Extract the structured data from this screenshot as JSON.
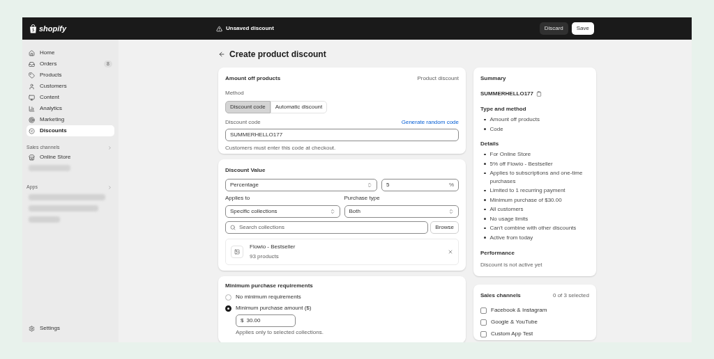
{
  "top_bar": {
    "logo_text": "shopify",
    "status": "Unsaved discount",
    "buttons": [
      {
        "label": "Discard",
        "kind": "secondary"
      },
      {
        "label": "Save",
        "kind": "primary"
      }
    ]
  },
  "sidebar": {
    "items": [
      {
        "label": "Home",
        "selected": false
      },
      {
        "label": "Orders",
        "badge": "8",
        "selected": false
      },
      {
        "label": "Products",
        "selected": false
      },
      {
        "label": "Customers",
        "selected": false
      },
      {
        "label": "Content",
        "selected": false
      },
      {
        "label": "Analytics",
        "selected": false
      },
      {
        "label": "Marketing",
        "selected": false
      },
      {
        "label": "Discounts",
        "selected": true
      }
    ],
    "sales_channels": {
      "heading": "Sales channels",
      "items": [
        {
          "label": "Online Store"
        }
      ]
    },
    "apps": {
      "heading": "Apps"
    },
    "settings": "Settings"
  },
  "page": {
    "title": "Create product discount"
  },
  "method_card": {
    "title": "Amount off products",
    "type_label": "Product discount",
    "method_label": "Method",
    "methods": [
      {
        "label": "Discount code",
        "selected": true
      },
      {
        "label": "Automatic discount",
        "selected": false
      }
    ],
    "code_label": "Discount code",
    "generate_link": "Generate random code",
    "code_value": "SUMMERHELLO177",
    "help": "Customers must enter this code at checkout."
  },
  "value_card": {
    "title": "Discount Value",
    "value_type": "Percentage",
    "amount": "5",
    "amount_suffix": "%",
    "applies_label": "Applies to",
    "applies_value": "Specific collections",
    "purchase_label": "Purchase type",
    "purchase_value": "Both",
    "search_placeholder": "Search collections",
    "browse": "Browse",
    "collections": [
      {
        "name": "Flowio - Bestseller",
        "count": "93 products"
      }
    ]
  },
  "requirements_card": {
    "title": "Minimum purchase requirements",
    "options": [
      {
        "label": "No minimum requirements",
        "selected": false
      },
      {
        "label": "Minimum purchase amount ($)",
        "selected": true
      }
    ],
    "amount_prefix": "$",
    "amount": "30.00",
    "help": "Applies only to selected collections."
  },
  "summary": {
    "title": "Summary",
    "code": "SUMMERHELLO177",
    "sections": [
      {
        "heading": "Type and method",
        "items": [
          "Amount off products",
          "Code"
        ]
      },
      {
        "heading": "Details",
        "items": [
          "For Online Store",
          "5% off Flowio - Bestseller",
          "Applies to subscriptions and one-time purchases",
          "Limited to 1 recurring payment",
          "Minimum purchase of $30.00",
          "All customers",
          "No usage limits",
          "Can't combine with other discounts",
          "Active from today"
        ]
      }
    ],
    "performance_heading": "Performance",
    "performance_text": "Discount is not active yet"
  },
  "sales_channels_card": {
    "title": "Sales channels",
    "count": "0 of 3 selected",
    "channels": [
      {
        "label": "Facebook & Instagram",
        "checked": false
      },
      {
        "label": "Google & YouTube",
        "checked": false
      },
      {
        "label": "Custom App Test",
        "checked": false
      }
    ]
  }
}
